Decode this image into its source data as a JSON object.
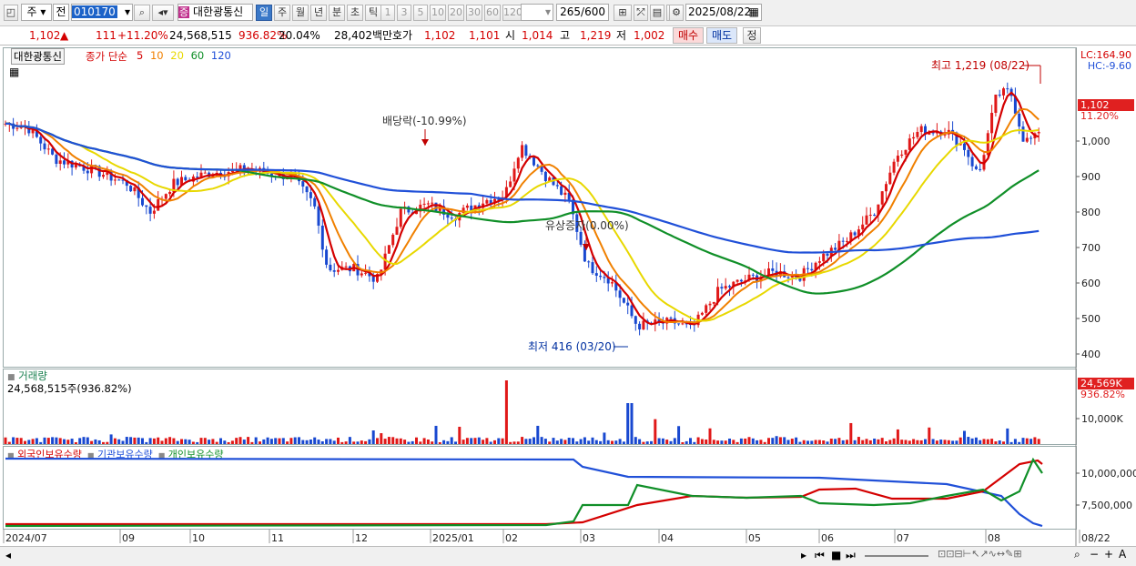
{
  "toolbar": {
    "market_sel": "주",
    "prev_label": "전",
    "code": "010170",
    "stock_name": "대한광통신",
    "name_prefix_badge": "증",
    "period_tabs": [
      "일",
      "주",
      "월",
      "년",
      "분",
      "초",
      "틱"
    ],
    "interval_buttons": [
      "1",
      "3",
      "5",
      "10",
      "20",
      "30",
      "60",
      "120"
    ],
    "count_value": "265",
    "count_max": "/600",
    "date_value": "2025/08/22"
  },
  "quote": {
    "price": "1,102",
    "up_arrow": "▲",
    "change": "111",
    "change_pct": "+11.20%",
    "volume": "24,568,515",
    "volume_ratio": "936.82%",
    "turnover": "20.04%",
    "amount": "28,402백만",
    "hoga_label": "호가",
    "ask": "1,102",
    "bid": "1,101",
    "open_label": "시",
    "open": "1,014",
    "high_label": "고",
    "high": "1,219",
    "low_label": "저",
    "low": "1,002",
    "buy_button": "매수",
    "sell_button": "매도",
    "correct_button": "정"
  },
  "price_pane": {
    "title": "대한광통신",
    "ma_label": "종가 단순",
    "ma_periods": [
      "5",
      "10",
      "20",
      "60",
      "120"
    ],
    "ma_colors": [
      "#d40000",
      "#f08000",
      "#e8d800",
      "#108f28",
      "#2050d8"
    ],
    "annotations": {
      "high": "최고 1,219 (08/22)",
      "low": "최저 416 (03/20)",
      "dividend": "배당락(-10.99%)",
      "rights": "유상증자(0.00%)"
    },
    "lc_label": "LC:164.90",
    "hc_label": "HC:-9.60",
    "last_price_tag": "1,102",
    "last_pct_tag": "11.20%",
    "y_ticks": [
      "1,000",
      "900",
      "800",
      "700",
      "600",
      "500",
      "400"
    ]
  },
  "volume_pane": {
    "title": "거래량",
    "value": "24,568,515주(936.82%)",
    "last_tag": "24,569K",
    "last_pct": "936.82%",
    "y_tick": "10,000K"
  },
  "holders_pane": {
    "legend": [
      "외국인보유수량",
      "기관보유수량",
      "개인보유수량"
    ],
    "colors": [
      "#d40000",
      "#2050d8",
      "#108f28"
    ],
    "y_ticks": [
      "10,000,000",
      "7,500,000"
    ]
  },
  "x_axis": [
    "2024/07",
    "09",
    "10",
    "11",
    "12",
    "2025/01",
    "02",
    "03",
    "04",
    "05",
    "06",
    "07",
    "08",
    "08/22"
  ],
  "chart_data": {
    "type": "line",
    "title": "",
    "series": [
      {
        "name": "종가",
        "x": [
          "2024/07",
          "2024/09",
          "2024/10",
          "2024/11",
          "2024/12",
          "2025/01",
          "2025/02",
          "2025/03",
          "2025/04",
          "2025/05",
          "2025/06",
          "2025/07",
          "2025/08",
          "2025/08/22"
        ],
        "values": [
          1050,
          900,
          890,
          910,
          640,
          820,
          950,
          620,
          490,
          600,
          690,
          950,
          1050,
          1102
        ]
      }
    ],
    "ylim": [
      380,
      1240
    ]
  }
}
